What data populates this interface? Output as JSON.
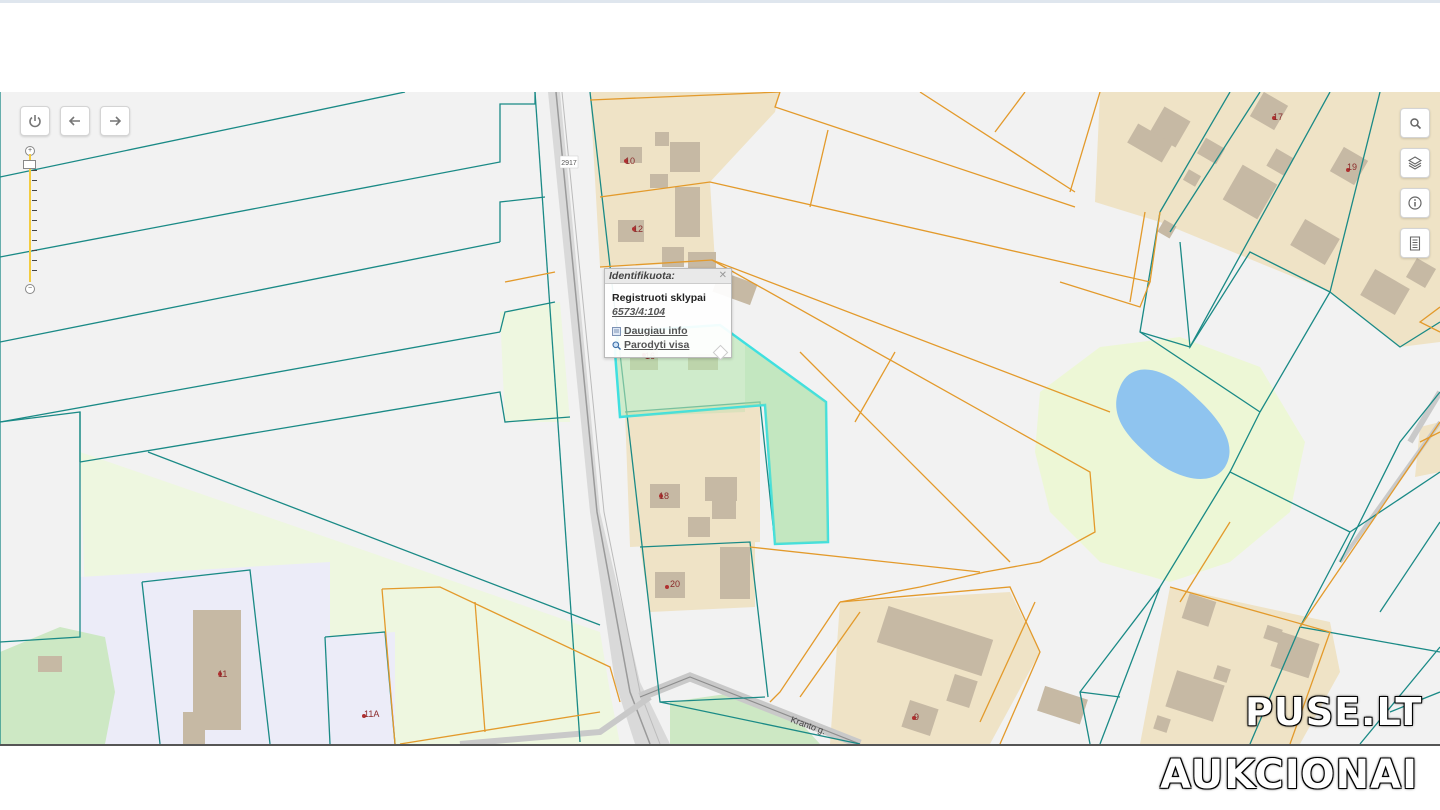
{
  "controls": {
    "power_icon": "power-icon",
    "back_icon": "arrow-left-icon",
    "forward_icon": "arrow-right-icon",
    "right_tools": [
      "search-icon",
      "layers-icon",
      "info-icon",
      "legend-icon"
    ]
  },
  "road_label": "2917",
  "street_label": "Kranto g.",
  "house_numbers": [
    "10",
    "12",
    "16",
    "18",
    "20",
    "17",
    "19",
    "11",
    "11A",
    "9"
  ],
  "popup": {
    "title": "Identifikuota:",
    "layer": "Registruoti sklypai",
    "parcel_id": "6573/4:104",
    "more_info": "Daugiau info",
    "show_all": "Parodyti visa"
  },
  "colors": {
    "selected_outline": "#3fe0e0",
    "selected_fill": "#b8e6b0",
    "parcel_teal": "#1a8a86",
    "parcel_orange": "#e39a2b",
    "water": "#8fc4ef",
    "building": "#c6b9a4"
  },
  "watermark": {
    "line1": "PUSE.LT",
    "line2": "AUKCIONAI"
  }
}
